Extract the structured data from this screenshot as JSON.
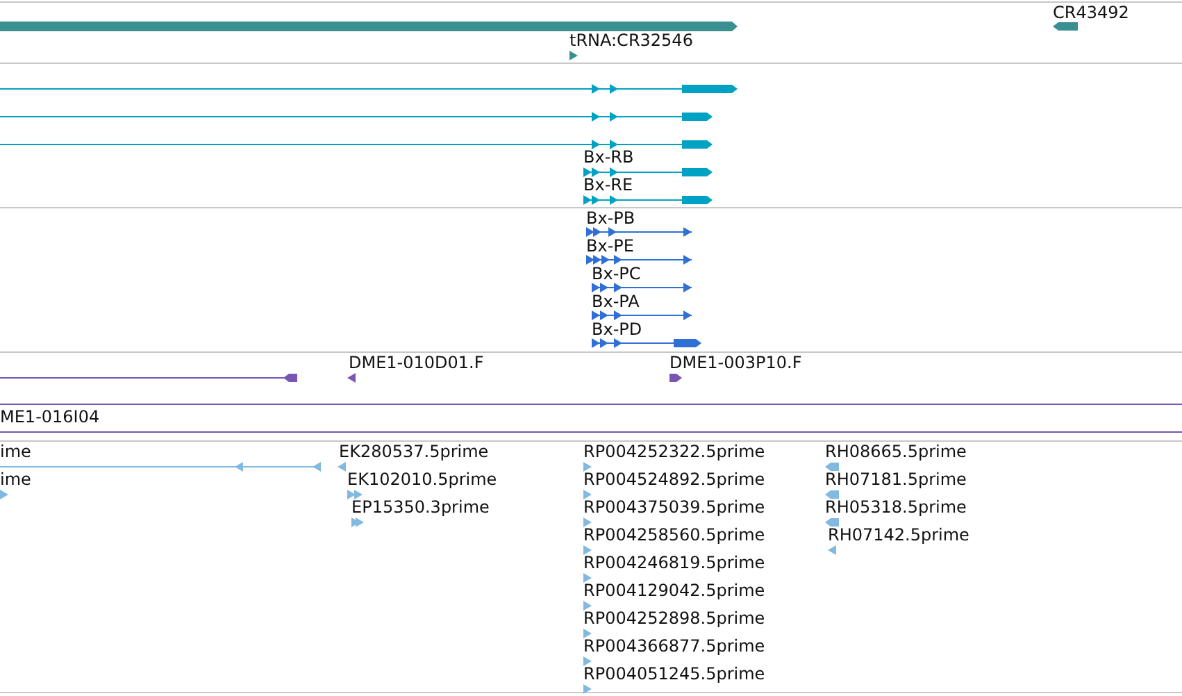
{
  "tracks": [
    {
      "kind": "gene",
      "features": [
        {
          "reverse": false
        },
        {
          "label": "CR43492",
          "reverse": true
        },
        {
          "label": "tRNA:CR32546",
          "reverse": false
        }
      ]
    },
    {
      "kind": "transcript",
      "features": [
        {
          "reverse": false
        },
        {
          "reverse": false
        },
        {
          "reverse": false
        },
        {
          "label": "Bx-RB",
          "reverse": false
        },
        {
          "label": "Bx-RE",
          "reverse": false
        }
      ]
    },
    {
      "kind": "protein",
      "features": [
        {
          "label": "Bx-PB",
          "reverse": false
        },
        {
          "label": "Bx-PE",
          "reverse": false
        },
        {
          "label": "Bx-PC",
          "reverse": false
        },
        {
          "label": "Bx-PA",
          "reverse": false
        },
        {
          "label": "Bx-PD",
          "reverse": false
        }
      ]
    },
    {
      "kind": "clone",
      "features": [
        {
          "reverse": true
        },
        {
          "label": "DME1-010D01.F",
          "reverse": true
        },
        {
          "label": "DME1-003P10.F",
          "reverse": false
        },
        {
          "label": "ME1-016I04"
        }
      ]
    },
    {
      "kind": "est",
      "features": [
        {
          "label": "ime",
          "reverse": true
        },
        {
          "label": "ime",
          "reverse": false
        },
        {
          "label": "EK280537.5prime",
          "reverse": true
        },
        {
          "label": "EK102010.5prime",
          "reverse": false
        },
        {
          "label": "EP15350.3prime",
          "reverse": false
        },
        {
          "label": "RP004252322.5prime",
          "reverse": false
        },
        {
          "label": "RP004524892.5prime",
          "reverse": false
        },
        {
          "label": "RP004375039.5prime",
          "reverse": false
        },
        {
          "label": "RP004258560.5prime",
          "reverse": false
        },
        {
          "label": "RP004246819.5prime",
          "reverse": false
        },
        {
          "label": "RP004129042.5prime",
          "reverse": false
        },
        {
          "label": "RP004252898.5prime",
          "reverse": false
        },
        {
          "label": "RP004366877.5prime",
          "reverse": false
        },
        {
          "label": "RP004051245.5prime",
          "reverse": false
        },
        {
          "label": "RH08665.5prime",
          "reverse": true
        },
        {
          "label": "RH07181.5prime",
          "reverse": true
        },
        {
          "label": "RH05318.5prime",
          "reverse": true
        },
        {
          "label": "RH07142.5prime",
          "reverse": true
        }
      ]
    }
  ]
}
